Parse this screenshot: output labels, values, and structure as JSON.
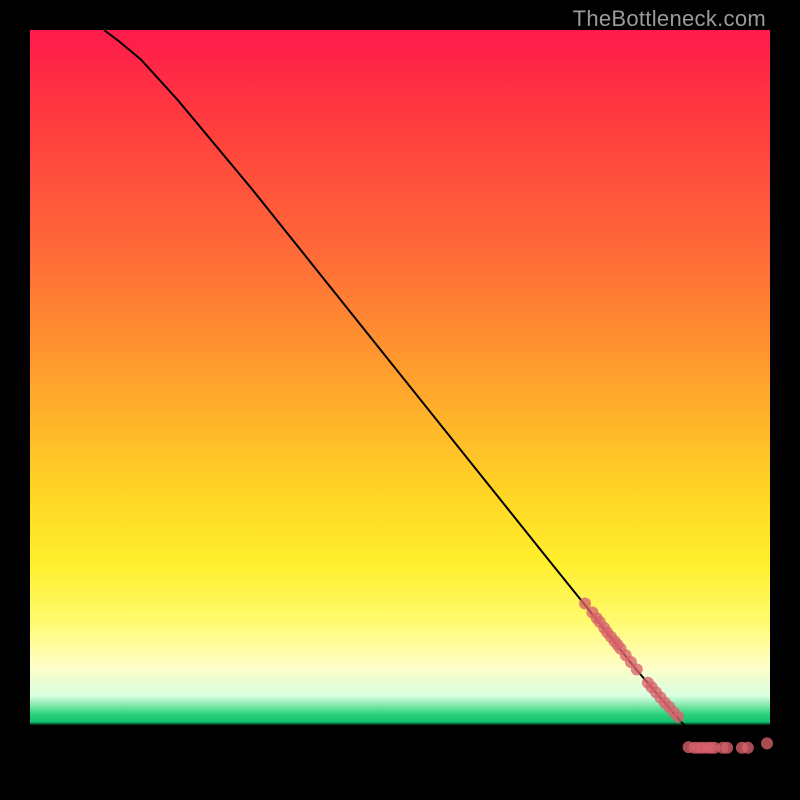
{
  "watermark": "TheBottleneck.com",
  "colors": {
    "dot": "#d9616a",
    "curve": "#000000"
  },
  "chart_data": {
    "type": "line",
    "title": "",
    "xlabel": "",
    "ylabel": "",
    "xlim": [
      0,
      100
    ],
    "ylim": [
      0,
      100
    ],
    "grid": false,
    "legend": false,
    "series": [
      {
        "name": "curve",
        "kind": "line",
        "x": [
          10,
          12,
          15,
          20,
          30,
          40,
          50,
          60,
          70,
          75,
          80,
          82,
          85,
          88,
          90,
          92,
          94,
          96,
          98,
          100
        ],
        "y": [
          100,
          98.5,
          96,
          90.5,
          78.5,
          66,
          53.5,
          41,
          28.5,
          22.3,
          16,
          13.5,
          10,
          6.5,
          4.5,
          3.3,
          3.0,
          3.0,
          3.0,
          3.5
        ]
      },
      {
        "name": "points-upper-cluster",
        "kind": "scatter",
        "x": [
          75,
          76,
          76.6,
          77,
          77.6,
          78,
          78.5,
          79,
          79.4,
          79.8,
          80.5,
          81.2,
          82.0
        ],
        "y": [
          22.5,
          21.3,
          20.5,
          20.0,
          19.2,
          18.6,
          18.0,
          17.4,
          16.9,
          16.4,
          15.5,
          14.6,
          13.6
        ]
      },
      {
        "name": "points-mid-cluster",
        "kind": "scatter",
        "x": [
          83.5,
          84.0,
          84.6,
          85.2,
          85.8,
          86.4,
          87.0,
          87.6
        ],
        "y": [
          11.8,
          11.2,
          10.5,
          9.8,
          9.1,
          8.5,
          7.8,
          7.2
        ]
      },
      {
        "name": "points-bottom-run",
        "kind": "scatter",
        "x": [
          89.0,
          89.8,
          90.4,
          90.9,
          91.5,
          92.0,
          92.5,
          93.6,
          94.2,
          96.2,
          97.0,
          99.6
        ],
        "y": [
          3.1,
          3.0,
          3.0,
          3.0,
          3.0,
          3.0,
          3.0,
          3.0,
          3.0,
          3.0,
          3.0,
          3.6
        ]
      }
    ]
  }
}
